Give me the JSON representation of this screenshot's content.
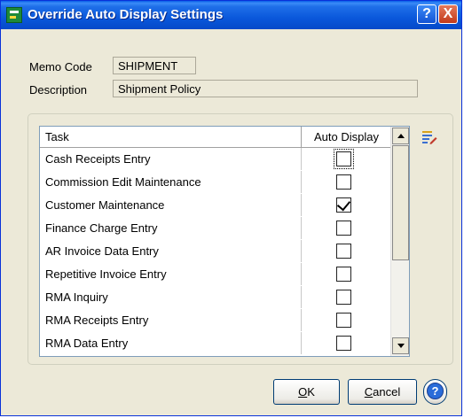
{
  "window": {
    "title": "Override Auto Display Settings"
  },
  "memo_code": {
    "label": "Memo Code",
    "value": "SHIPMENT"
  },
  "description": {
    "label": "Description",
    "value": "Shipment Policy"
  },
  "grid": {
    "columns": [
      "Task",
      "Auto Display"
    ],
    "rows": [
      {
        "task": "Cash Receipts Entry",
        "auto_display": false
      },
      {
        "task": "Commission Edit Maintenance",
        "auto_display": false
      },
      {
        "task": "Customer Maintenance",
        "auto_display": true
      },
      {
        "task": "Finance Charge Entry",
        "auto_display": false
      },
      {
        "task": "AR Invoice Data Entry",
        "auto_display": false
      },
      {
        "task": "Repetitive Invoice Entry",
        "auto_display": false
      },
      {
        "task": "RMA Inquiry",
        "auto_display": false
      },
      {
        "task": "RMA Receipts Entry",
        "auto_display": false
      },
      {
        "task": "RMA Data Entry",
        "auto_display": false
      }
    ]
  },
  "buttons": {
    "ok_mnemonic": "O",
    "ok_rest": "K",
    "cancel_mnemonic": "C",
    "cancel_rest": "ancel",
    "help_glyph": "?"
  },
  "titlebar_buttons": {
    "help": "?",
    "close": "X"
  },
  "colors": {
    "title_blue": "#0a58db",
    "dialog_bg": "#ece9d8",
    "close_red": "#c23a1a"
  },
  "icons": {
    "app": "app-icon",
    "side": "edit-list-icon",
    "help": "help-icon"
  }
}
